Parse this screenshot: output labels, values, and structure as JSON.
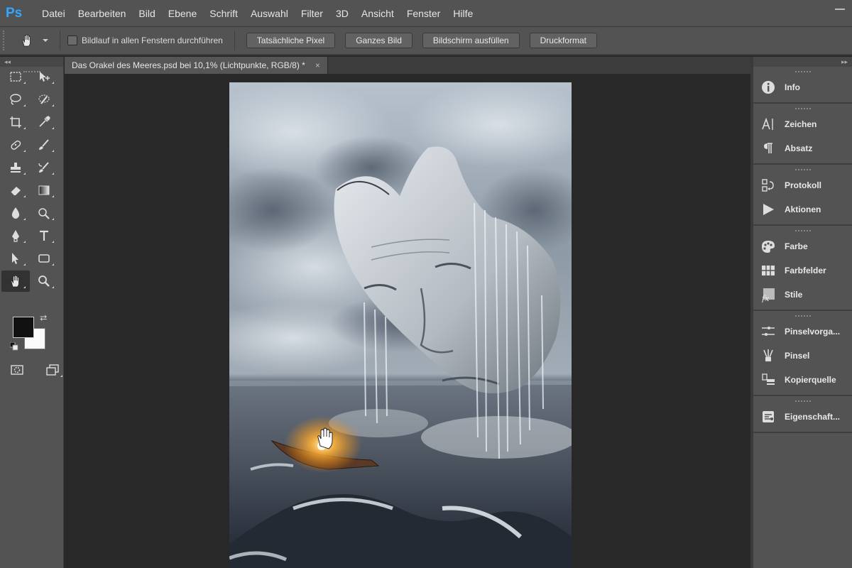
{
  "app": {
    "logo": "Ps"
  },
  "menu": [
    "Datei",
    "Bearbeiten",
    "Bild",
    "Ebene",
    "Schrift",
    "Auswahl",
    "Filter",
    "3D",
    "Ansicht",
    "Fenster",
    "Hilfe"
  ],
  "options": {
    "scroll_all_label": "Bildlauf in allen Fenstern durchführen",
    "buttons": [
      "Tatsächliche Pixel",
      "Ganzes Bild",
      "Bildschirm ausfüllen",
      "Druckformat"
    ]
  },
  "document": {
    "tab_title": "Das Orakel des Meeres.psd bei 10,1% (Lichtpunkte, RGB/8) *",
    "close_glyph": "×"
  },
  "tools": [
    [
      "rectangular-marquee-icon",
      "move-icon"
    ],
    [
      "lasso-icon",
      "quick-selection-icon"
    ],
    [
      "crop-icon",
      "eyedropper-icon"
    ],
    [
      "healing-brush-icon",
      "brush-icon"
    ],
    [
      "clone-stamp-icon",
      "history-brush-icon"
    ],
    [
      "eraser-icon",
      "gradient-icon"
    ],
    [
      "blur-icon",
      "dodge-icon"
    ],
    [
      "pen-icon",
      "type-icon"
    ],
    [
      "path-selection-icon",
      "shape-icon"
    ],
    [
      "hand-icon",
      "zoom-icon"
    ]
  ],
  "colors": {
    "foreground": "#111111",
    "background": "#fafafa"
  },
  "right_panel": {
    "groups": [
      [
        {
          "label": "Info",
          "icon": "info-icon"
        }
      ],
      [
        {
          "label": "Zeichen",
          "icon": "character-icon"
        },
        {
          "label": "Absatz",
          "icon": "paragraph-icon"
        }
      ],
      [
        {
          "label": "Protokoll",
          "icon": "history-icon"
        },
        {
          "label": "Aktionen",
          "icon": "actions-icon"
        }
      ],
      [
        {
          "label": "Farbe",
          "icon": "color-icon"
        },
        {
          "label": "Farbfelder",
          "icon": "swatches-icon"
        },
        {
          "label": "Stile",
          "icon": "styles-icon"
        }
      ],
      [
        {
          "label": "Pinselvorga...",
          "icon": "brush-presets-icon"
        },
        {
          "label": "Pinsel",
          "icon": "brush-panel-icon"
        },
        {
          "label": "Kopierquelle",
          "icon": "clone-source-icon"
        }
      ],
      [
        {
          "label": "Eigenschaft...",
          "icon": "properties-icon"
        }
      ]
    ]
  }
}
